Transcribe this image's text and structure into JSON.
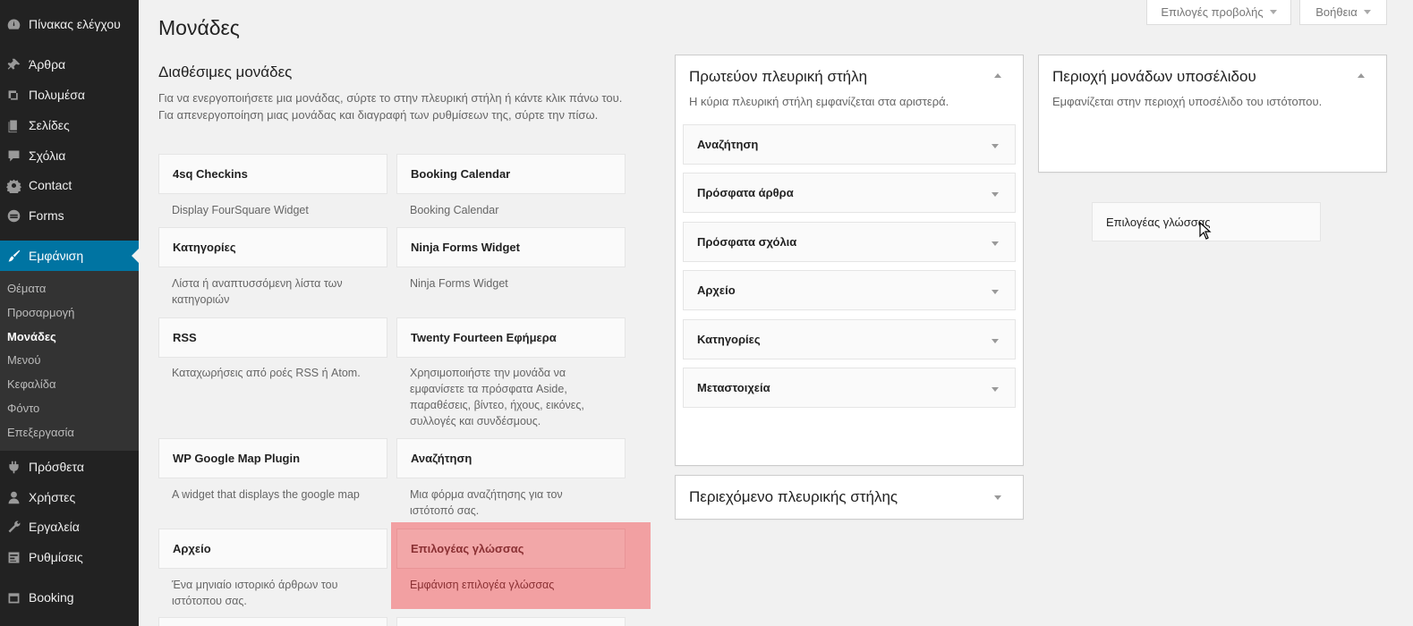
{
  "admin_menu": {
    "dashboard": "Πίνακας ελέγχου",
    "posts": "Άρθρα",
    "media": "Πολυμέσα",
    "pages": "Σελίδες",
    "comments": "Σχόλια",
    "contact": "Contact",
    "forms": "Forms",
    "appearance": "Εμφάνιση",
    "submenu": [
      "Θέματα",
      "Προσαρμογή",
      "Μονάδες",
      "Μενού",
      "Κεφαλίδα",
      "Φόντο",
      "Επεξεργασία"
    ],
    "plugins": "Πρόσθετα",
    "users": "Χρήστες",
    "tools": "Εργαλεία",
    "settings": "Ρυθμίσεις",
    "booking": "Booking"
  },
  "screen_options_label": "Επιλογές προβολής",
  "help_label": "Βοήθεια",
  "page_title": "Μονάδες",
  "available": {
    "title": "Διαθέσιμες μονάδες",
    "description": "Για να ενεργοποιήσετε μια μονάδας, σύρτε το στην πλευρική στήλη ή κάντε κλικ πάνω του. Για απενεργοποίηση μιας μονάδας και διαγραφή των ρυθμίσεων της, σύρτε την πίσω.",
    "widgets": [
      {
        "title": "4sq Checkins",
        "desc": "Display FourSquare Widget"
      },
      {
        "title": "Booking Calendar",
        "desc": "Booking Calendar"
      },
      {
        "title": "Κατηγορίες",
        "desc": "Λίστα ή αναπτυσσόμενη λίστα των κατηγοριών"
      },
      {
        "title": "Ninja Forms Widget",
        "desc": "Ninja Forms Widget"
      },
      {
        "title": "RSS",
        "desc": "Καταχωρήσεις από ροές RSS ή Atom."
      },
      {
        "title": "Twenty Fourteen Εφήμερα",
        "desc": "Χρησιμοποιήστε την μονάδα να εμφανίσετε τα πρόσφατα Aside, παραθέσεις, βίντεο, ήχους, εικόνες, συλλογές και συνδέσμους."
      },
      {
        "title": "WP Google Map Plugin",
        "desc": "A widget that displays the google map"
      },
      {
        "title": "Αναζήτηση",
        "desc": "Μια φόρμα αναζήτησης για τον ιστότοπό σας."
      },
      {
        "title": "Αρχείο",
        "desc": "Ένα μηνιαίο ιστορικό άρθρων του ιστότοπου σας."
      },
      {
        "title": "Επιλογέας γλώσσας",
        "desc": "Εμφάνιση επιλογέα γλώσσας"
      }
    ]
  },
  "primary_sidebar": {
    "title": "Πρωτεύον πλευρική στήλη",
    "description": "Η κύρια πλευρική στήλη εμφανίζεται στα αριστερά.",
    "widgets": [
      "Αναζήτηση",
      "Πρόσφατα άρθρα",
      "Πρόσφατα σχόλια",
      "Αρχείο",
      "Κατηγορίες",
      "Μεταστοιχεία"
    ]
  },
  "content_sidebar": {
    "title": "Περιεχόμενο πλευρικής στήλης"
  },
  "footer_widget_area": {
    "title": "Περιοχή μονάδων υποσέλιδου",
    "description": "Εμφανίζεται στην περιοχή υποσέλιδο του ιστότοπου."
  },
  "drag_ghost_label": "Επιλογέας γλώσσας",
  "colors": {
    "menu_bg": "#222222",
    "menu_current": "#0074a2",
    "highlight": "#f2a0a2"
  }
}
